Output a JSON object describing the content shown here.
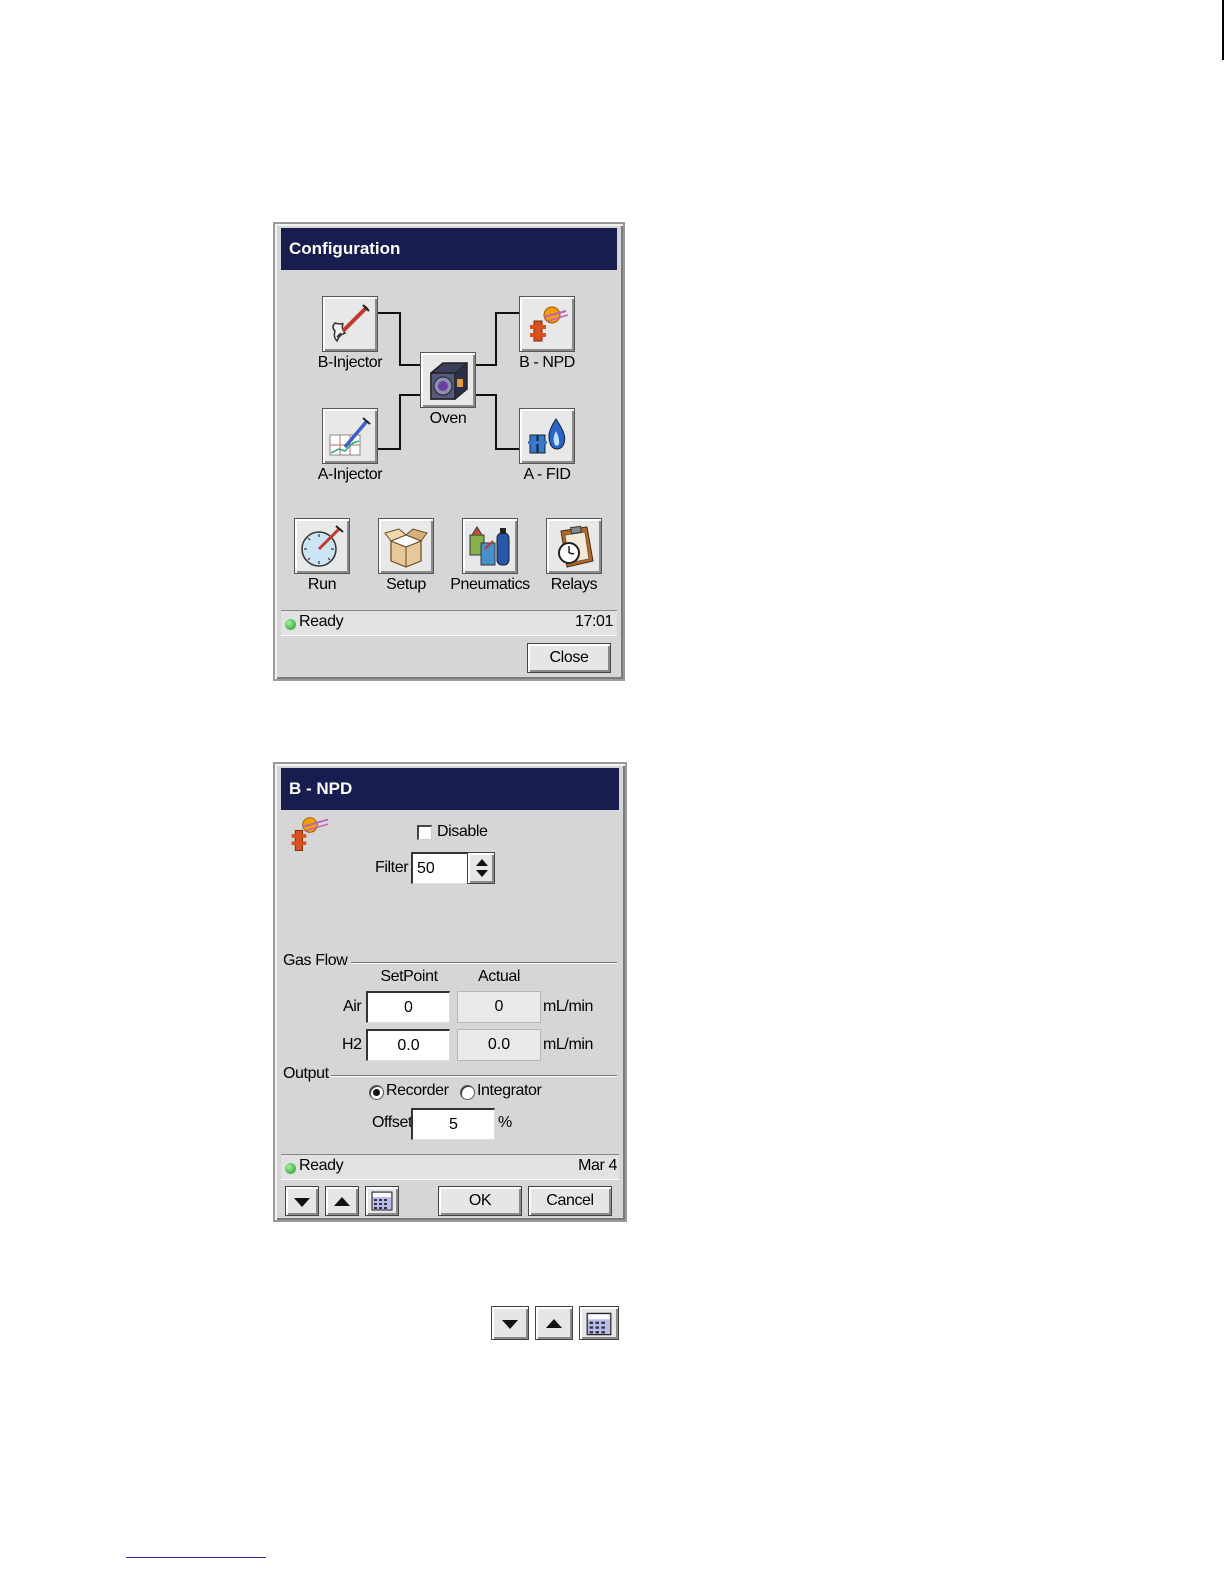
{
  "config_window": {
    "title": "Configuration",
    "modules": {
      "b_injector": "B-Injector",
      "a_injector": "A-Injector",
      "oven": "Oven",
      "b_npd": "B - NPD",
      "a_fid": "A - FID"
    },
    "tools": {
      "run": "Run",
      "setup": "Setup",
      "pneumatics": "Pneumatics",
      "relays": "Relays"
    },
    "status": {
      "text": "Ready",
      "time": "17:01"
    },
    "close_label": "Close"
  },
  "npd_window": {
    "title": "B - NPD",
    "disable_label": "Disable",
    "filter_label": "Filter",
    "filter_value": "50",
    "gas_flow": {
      "section_label": "Gas Flow",
      "setpoint_header": "SetPoint",
      "actual_header": "Actual",
      "rows": [
        {
          "label": "Air",
          "setpoint": "0",
          "actual": "0",
          "unit": "mL/min"
        },
        {
          "label": "H2",
          "setpoint": "0.0",
          "actual": "0.0",
          "unit": "mL/min"
        }
      ]
    },
    "output": {
      "section_label": "Output",
      "recorder_label": "Recorder",
      "integrator_label": "Integrator",
      "selected": "Recorder",
      "offset_label": "Offset",
      "offset_value": "5",
      "offset_unit": "%"
    },
    "status": {
      "text": "Ready",
      "date": "Mar 4"
    },
    "ok_label": "OK",
    "cancel_label": "Cancel"
  }
}
